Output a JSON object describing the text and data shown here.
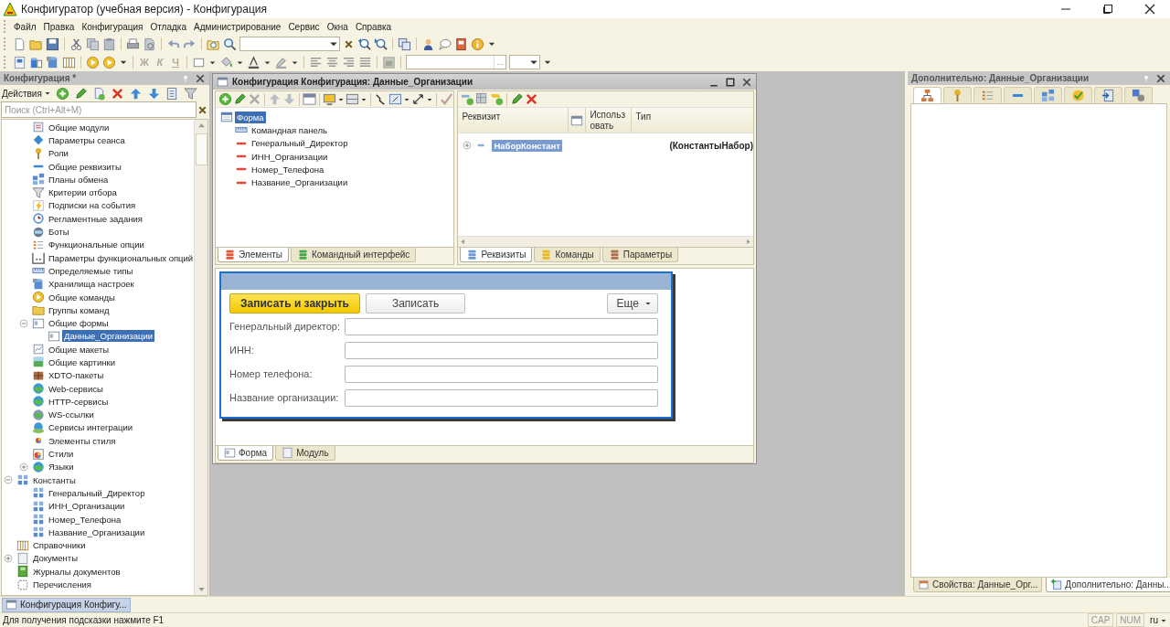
{
  "window": {
    "title": "Конфигуратор (учебная версия) - Конфигурация"
  },
  "menu": [
    "Файл",
    "Правка",
    "Конфигурация",
    "Отладка",
    "Администрирование",
    "Сервис",
    "Окна",
    "Справка"
  ],
  "format_buttons": [
    {
      "label": "Ж",
      "disabled": true
    },
    {
      "label": "К",
      "disabled": true
    },
    {
      "label": "Ч",
      "disabled": true
    }
  ],
  "toolbar_field_button": "...",
  "config_panel": {
    "title": "Конфигурация *",
    "actions": "Действия",
    "search": {
      "placeholder": "Поиск (Ctrl+Alt+M)"
    },
    "tree": [
      {
        "children": [
          {
            "label": "Общие модули",
            "selected": false
          },
          {
            "label": "Параметры сеанса",
            "selected": false
          },
          {
            "label": "Роли",
            "selected": false
          },
          {
            "label": "Общие реквизиты",
            "selected": false
          },
          {
            "label": "Планы обмена",
            "selected": false
          },
          {
            "label": "Критерии отбора",
            "selected": false
          },
          {
            "label": "Подписки на события",
            "selected": false
          },
          {
            "label": "Регламентные задания",
            "selected": false
          },
          {
            "label": "Боты",
            "selected": false
          },
          {
            "label": "Функциональные опции",
            "selected": false
          },
          {
            "label": "Параметры функциональных опций",
            "selected": false
          },
          {
            "label": "Определяемые типы",
            "selected": false
          },
          {
            "label": "Хранилища настроек",
            "selected": false
          },
          {
            "label": "Общие команды",
            "selected": false
          },
          {
            "label": "Группы команд",
            "selected": false
          },
          {
            "label": "Общие формы",
            "selected": false,
            "expanded": true,
            "children": [
              {
                "label": "Данные_Организации",
                "selected": true
              }
            ]
          },
          {
            "label": "Общие макеты",
            "selected": false
          },
          {
            "label": "Общие картинки",
            "selected": false
          },
          {
            "label": "XDTO-пакеты",
            "selected": false
          },
          {
            "label": "Web-сервисы",
            "selected": false
          },
          {
            "label": "HTTP-сервисы",
            "selected": false
          },
          {
            "label": "WS-ссылки",
            "selected": false
          },
          {
            "label": "Сервисы интеграции",
            "selected": false
          },
          {
            "label": "Элементы стиля",
            "selected": false
          },
          {
            "label": "Стили",
            "selected": false
          },
          {
            "label": "Языки",
            "selected": false,
            "expanded": false
          }
        ]
      },
      {
        "label": "Константы",
        "selected": false,
        "expanded": true,
        "children": [
          {
            "label": "Генеральный_Директор",
            "selected": false
          },
          {
            "label": "ИНН_Организации",
            "selected": false
          },
          {
            "label": "Номер_Телефона",
            "selected": false
          },
          {
            "label": "Название_Организации",
            "selected": false
          }
        ]
      },
      {
        "label": "Справочники",
        "selected": false
      },
      {
        "label": "Документы",
        "selected": false,
        "expanded": false
      },
      {
        "label": "Журналы документов",
        "selected": false
      },
      {
        "label": "Перечисления",
        "selected": false
      }
    ]
  },
  "editor": {
    "title": "Конфигурация Конфигурация: Данные_Организации",
    "elements": {
      "tree": [
        {
          "label": "Форма",
          "selected": true,
          "children": [
            {
              "label": "Командная панель",
              "selected": false
            },
            {
              "label": "Генеральный_Директор",
              "selected": false
            },
            {
              "label": "ИНН_Организации",
              "selected": false
            },
            {
              "label": "Номер_Телефона",
              "selected": false
            },
            {
              "label": "Название_Организации",
              "selected": false
            }
          ]
        }
      ],
      "tabs": [
        {
          "label": "Элементы",
          "selected": true
        },
        {
          "label": "Командный интерфейс",
          "selected": false
        }
      ]
    },
    "attributes": {
      "columns": [
        "Реквизит",
        "Использовать",
        "Тип"
      ],
      "rows": [
        {
          "name": "НаборКонстант",
          "type": "(КонстантыНабор)",
          "expanded": false,
          "selected": true
        }
      ],
      "tabs": [
        {
          "label": "Реквизиты",
          "selected": true
        },
        {
          "label": "Команды",
          "selected": false
        },
        {
          "label": "Параметры",
          "selected": false
        }
      ]
    },
    "form_preview": {
      "buttons": [
        {
          "label": "Записать и закрыть",
          "kind": "default"
        },
        {
          "label": "Записать",
          "kind": "normal"
        }
      ],
      "more": "Еще",
      "fields": [
        {
          "label": "Генеральный директор:"
        },
        {
          "label": "ИНН:"
        },
        {
          "label": "Номер телефона:"
        },
        {
          "label": "Название организации:"
        }
      ]
    },
    "tabs": [
      {
        "label": "Форма",
        "selected": true
      },
      {
        "label": "Модуль",
        "selected": false
      }
    ]
  },
  "properties_panel": {
    "title": "Дополнительно: Данные_Организации",
    "tabs": [
      {
        "selected": true
      },
      {
        "selected": false
      },
      {
        "selected": false
      },
      {
        "selected": false
      },
      {
        "selected": false
      },
      {
        "selected": false
      },
      {
        "selected": false
      },
      {
        "selected": false
      }
    ],
    "bottom_tabs": [
      {
        "label": "Свойства: Данные_Орг...",
        "selected": false
      },
      {
        "label": "Дополнительно: Данны...",
        "selected": true
      }
    ]
  },
  "taskbar": [
    {
      "label": "Конфигурация Конфигу...",
      "selected": true
    }
  ],
  "status_bar": {
    "hint": "Для получения подсказки нажмите F1",
    "indicators": [
      "CAP",
      "NUM"
    ],
    "language": "ru"
  }
}
